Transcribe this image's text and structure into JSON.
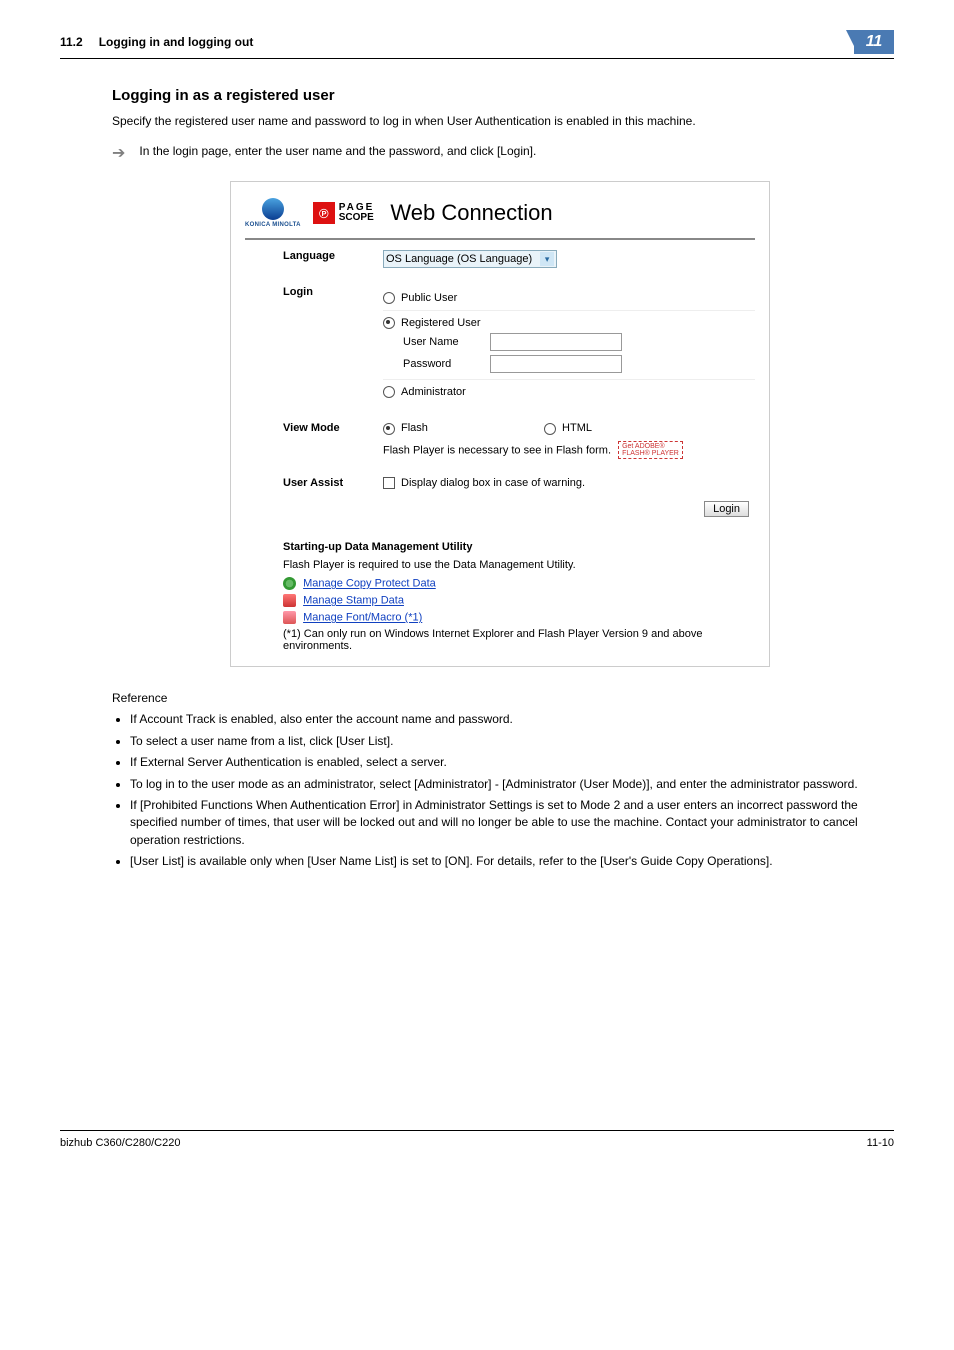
{
  "header": {
    "section_num": "11.2",
    "section_title": "Logging in and logging out",
    "page_badge": "11"
  },
  "main": {
    "heading": "Logging in as a registered user",
    "intro": "Specify the registered user name and password to log in when User Authentication is enabled in this machine.",
    "step": "In the login page, enter the user name and the password, and click [Login]."
  },
  "ui": {
    "brand_small": "KONICA MINOLTA",
    "brand_page": "PAGE",
    "brand_scope": "SCOPE",
    "brand_web": "Web",
    "brand_conn": "Connection",
    "language_label": "Language",
    "language_value": "OS Language (OS Language)",
    "login_label": "Login",
    "public_user": "Public User",
    "registered_user": "Registered User",
    "user_name": "User Name",
    "password": "Password",
    "administrator": "Administrator",
    "viewmode_label": "View Mode",
    "flash": "Flash",
    "html": "HTML",
    "flash_note": "Flash Player is necessary to see in Flash form.",
    "flash_badge_l1": "Get ADOBE®",
    "flash_badge_l2": "FLASH® PLAYER",
    "userassist_label": "User Assist",
    "userassist_opt": "Display dialog box in case of warning.",
    "login_button": "Login",
    "dmu": {
      "title": "Starting-up Data Management Utility",
      "note": "Flash Player is required to use the Data Management Utility.",
      "link1": "Manage Copy Protect Data",
      "link2": "Manage Stamp Data",
      "link3": "Manage Font/Macro (*1)",
      "foot": "(*1) Can only run on Windows Internet Explorer and Flash Player Version 9 and above environments."
    }
  },
  "reference": {
    "heading": "Reference",
    "items": [
      "If Account Track is enabled, also enter the account name and password.",
      "To select a user name from a list, click [User List].",
      "If External Server Authentication is enabled, select a server.",
      "To log in to the user mode as an administrator, select [Administrator] - [Administrator (User Mode)], and enter the administrator password.",
      "If [Prohibited Functions When Authentication Error] in Administrator Settings is set to Mode 2 and a user enters an incorrect password the specified number of times, that user will be locked out and will no longer be able to use the machine. Contact your administrator to cancel operation restrictions.",
      "[User List] is available only when [User Name List] is set to [ON]. For details, refer to the [User's Guide Copy Operations]."
    ]
  },
  "footer": {
    "model": "bizhub C360/C280/C220",
    "page": "11-10"
  }
}
